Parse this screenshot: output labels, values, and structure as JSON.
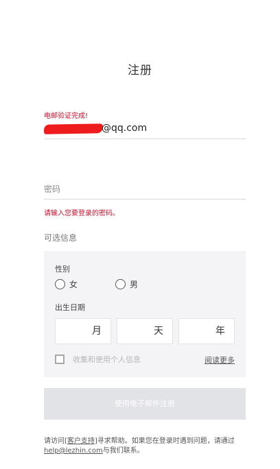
{
  "page": {
    "title": "注册"
  },
  "email": {
    "status": "电邮验证完成!",
    "value_suffix": "@qq.com"
  },
  "password": {
    "placeholder": "密码",
    "error": "请输入您要登录的密码。"
  },
  "optional": {
    "title": "可选信息",
    "gender_label": "性别",
    "gender_options": [
      "女",
      "男"
    ],
    "birth_label": "出生日期",
    "date_fields": {
      "month": "月",
      "day": "天",
      "year": "年"
    },
    "consent_label": "收集和使用个人信息",
    "read_more": "阅读更多"
  },
  "submit": {
    "label": "使用电子邮件注册"
  },
  "help": {
    "prefix": "请访问[",
    "support_link": "客户支持",
    "middle": "]寻求帮助。如果您在登录时遇到问题，请通过",
    "email_link": "help@lezhin.com",
    "suffix": "与我们联系。"
  },
  "colors": {
    "error": "#c8102e",
    "redaction": "#ee1c1c",
    "submit_disabled": "#e2e3e7"
  }
}
